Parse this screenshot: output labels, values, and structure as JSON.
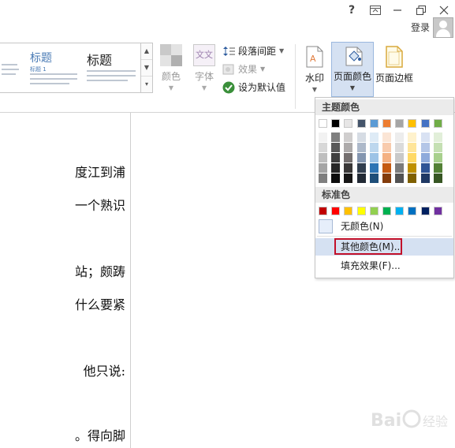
{
  "titlebar": {
    "help": "?",
    "ribbon_display": "⧉",
    "minimize": "—",
    "restore": "❐",
    "close": "✕",
    "login": "登录"
  },
  "gallery": {
    "item1_title": "标题",
    "item1_sub": "标题 1",
    "item2_title": "标题"
  },
  "ribbon": {
    "colors": "颜色",
    "fonts": "字体",
    "fonts_icon_text": "文文",
    "paragraph_spacing": "段落间距",
    "effects": "效果",
    "set_default": "设为默认值",
    "watermark": "水印",
    "page_color": "页面颜色",
    "page_borders": "页面边框"
  },
  "document": {
    "lines": [
      "度江到浦",
      "一个熟识",
      "站；颇踌",
      "什么要紧",
      "他只说:",
      "。得向脚"
    ]
  },
  "menu": {
    "theme_colors": "主题颜色",
    "standard_colors": "标准色",
    "no_color": "无颜色(N)",
    "more_colors": "其他颜色(M)...",
    "fill_effects": "填充效果(F)..."
  },
  "theme_palette": {
    "top_row": [
      "#ffffff",
      "#000000",
      "#e7e6e6",
      "#44546a",
      "#5b9bd5",
      "#ed7d31",
      "#a5a5a5",
      "#ffc000",
      "#4472c4",
      "#70ad47"
    ],
    "shades": [
      [
        "#f2f2f2",
        "#7f7f7f",
        "#d0cece",
        "#d6dce4",
        "#deebf6",
        "#fbe5d5",
        "#ededed",
        "#fff2cc",
        "#d9e2f3",
        "#e2efd9"
      ],
      [
        "#d8d8d8",
        "#595959",
        "#aeabab",
        "#adb9ca",
        "#bdd7ee",
        "#f8cbad",
        "#dbdbdb",
        "#ffe599",
        "#b4c6e7",
        "#c5e0b3"
      ],
      [
        "#bfbfbf",
        "#3f3f3f",
        "#757070",
        "#8496b0",
        "#9dc3e6",
        "#f4b183",
        "#c9c9c9",
        "#ffd965",
        "#8eaadb",
        "#a8d08d"
      ],
      [
        "#a5a5a5",
        "#262626",
        "#3a3838",
        "#323f4f",
        "#2e75b5",
        "#c55a11",
        "#7b7b7b",
        "#bf9000",
        "#2f5496",
        "#538135"
      ],
      [
        "#7f7f7f",
        "#0c0c0c",
        "#171616",
        "#222a35",
        "#1e4e79",
        "#833c0b",
        "#525252",
        "#7f6000",
        "#1f3864",
        "#375623"
      ]
    ]
  },
  "standard_palette": [
    "#c00000",
    "#ff0000",
    "#ffc000",
    "#ffff00",
    "#92d050",
    "#00b050",
    "#00b0f0",
    "#0070c0",
    "#002060",
    "#7030a0"
  ],
  "watermark_text": "Bai经验"
}
